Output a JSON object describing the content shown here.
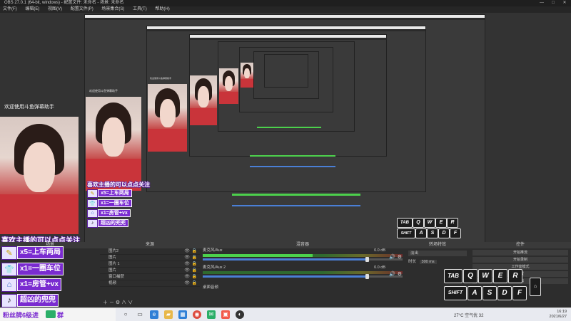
{
  "window": {
    "title": "OBS 27.0.1 (64-bit, windows) - 配置文件: 未命名 - 场景: 未命名",
    "controls": [
      "—",
      "□",
      "✕"
    ]
  },
  "menu": [
    "文件(F)",
    "编辑(E)",
    "视图(V)",
    "配置文件(P)",
    "场景集合(S)",
    "工具(T)",
    "帮助(H)"
  ],
  "preview": {
    "welcome_text": "欢迎使用斗鱼弹幕助手",
    "banner_text": "喜欢主播的可以点点关注",
    "chat_rows": [
      {
        "icon": "pencil-icon",
        "text": "x5=上车两局"
      },
      {
        "icon": "shirt-icon",
        "text": "x1=一圈车位"
      },
      {
        "icon": "house-icon",
        "text": "x1=房管+vx"
      },
      {
        "icon": "tiktok-icon",
        "text": "超凶的兜兜"
      }
    ],
    "fans_text": "粉丝牌6级进",
    "fans_suffix": "群",
    "keys_row1": [
      "TAB",
      "Q",
      "W",
      "E",
      "R"
    ],
    "keys_row2": [
      "SHIFT",
      "A",
      "S",
      "D",
      "F"
    ]
  },
  "docks": {
    "scenes_header": "场景",
    "sources_header": "来源",
    "mixer_header": "混音器",
    "transitions_header": "转场特效",
    "controls_header": "控件"
  },
  "sources": [
    "图片2",
    "图片",
    "图片 1",
    "图片",
    "窗口捕获",
    "视频"
  ],
  "mixer": [
    {
      "name": "麦克风/Aux",
      "db": "0.0 dB",
      "level": 0.55,
      "volume": 0.82
    },
    {
      "name": "麦克风/Aux 2",
      "db": "0.0 dB",
      "level": 0.0,
      "volume": 0.82
    }
  ],
  "mixer_footer": "桌面音频",
  "transitions": {
    "type": "淡出",
    "duration_label": "时长",
    "duration_value": "300 ms"
  },
  "controls": [
    "开始推流",
    "开始录制",
    "工作室模式",
    "设置",
    "退出"
  ],
  "taskbar": {
    "weather": "27°C  空气优 32",
    "time": "16:19",
    "date": "2021/6/27"
  },
  "colors": {
    "banner_purple": "#7a2bd0",
    "meter_green": "#4cd14c",
    "volume_blue": "#4a7fd6"
  }
}
